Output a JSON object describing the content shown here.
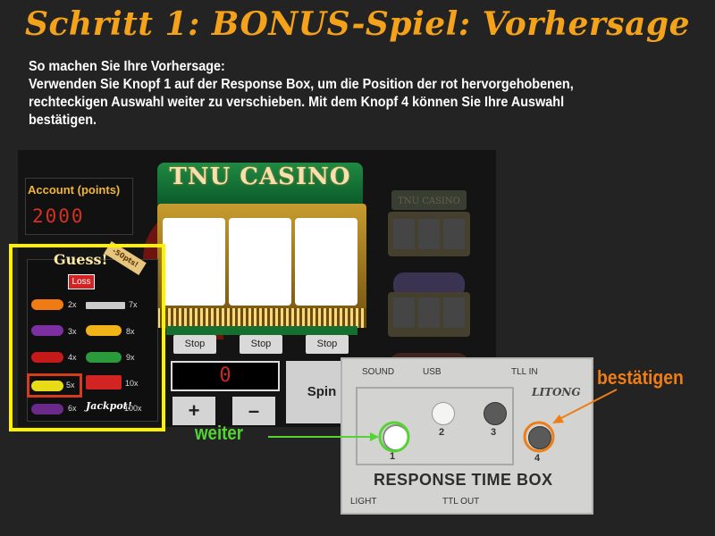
{
  "header": {
    "title": "Schritt 1: BONUS-Spiel: Vorhersage"
  },
  "instructions": {
    "line1": "So machen Sie Ihre Vorhersage:",
    "line2": "Verwenden Sie Knopf 1 auf der Response Box, um die Position der rot hervorgehobenen,",
    "line3": "rechteckigen Auswahl weiter zu verschieben. Mit dem Knopf 4 können Sie Ihre Auswahl",
    "line4": "bestätigen."
  },
  "account": {
    "label": "Account (points)",
    "value": "2000"
  },
  "guess_panel": {
    "title": "Guess!",
    "points_ribbon": "-50pts!",
    "loss_label": "Loss",
    "left_column": [
      {
        "icon": "orange-icon",
        "multiplier": "2x"
      },
      {
        "icon": "grapes-icon",
        "multiplier": "3x"
      },
      {
        "icon": "cherry-icon",
        "multiplier": "4x"
      },
      {
        "icon": "lemon-icon",
        "multiplier": "5x"
      },
      {
        "icon": "plum-icon",
        "multiplier": "6x"
      }
    ],
    "right_column": [
      {
        "icon": "bar-icon",
        "multiplier": "7x"
      },
      {
        "icon": "bell-icon",
        "multiplier": "8x"
      },
      {
        "icon": "watermelon-icon",
        "multiplier": "9x"
      },
      {
        "icon": "seven-icon",
        "multiplier": "10x"
      },
      {
        "icon": "jackpot-icon",
        "label": "Jackpot!",
        "multiplier": "100x"
      }
    ],
    "selected_index": 3
  },
  "slot_machine": {
    "title": "TNU CASINO",
    "stop_label": "Stop",
    "counter": "0",
    "plus_label": "+",
    "minus_label": "–",
    "spin_label": "Spin",
    "ghost_title": "TNU CASINO"
  },
  "response_box": {
    "sound": "SOUND",
    "usb": "USB",
    "ttl_in": "TLL IN",
    "brand": "LITONG",
    "title": "RESPONSE TIME BOX",
    "light": "LIGHT",
    "ttl_out": "TTL OUT",
    "keys": [
      "1",
      "2",
      "3",
      "4"
    ]
  },
  "annotations": {
    "next": "weiter",
    "confirm": "bestätigen",
    "next_color": "#53d432",
    "confirm_color": "#ef7d16",
    "highlight_color": "#fff200"
  }
}
